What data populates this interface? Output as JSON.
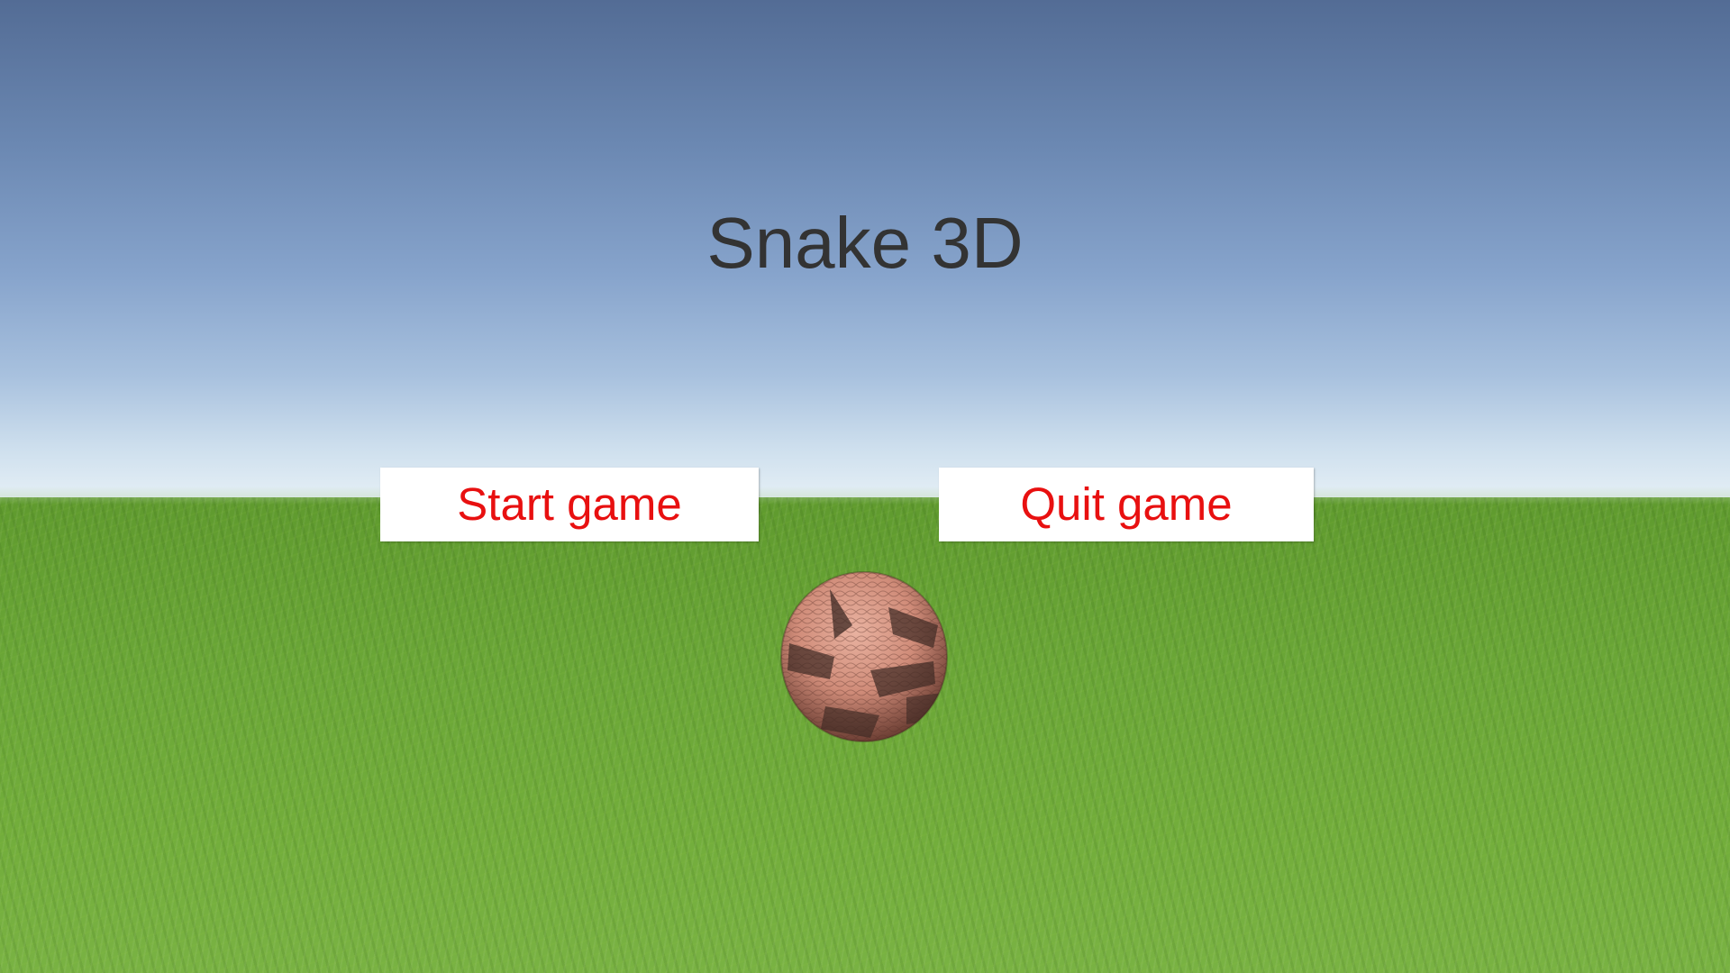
{
  "game": {
    "title": "Snake 3D"
  },
  "menu": {
    "start_label": "Start game",
    "quit_label": "Quit game"
  },
  "colors": {
    "button_text": "#e81010",
    "button_background": "#ffffff",
    "title_text": "#333333"
  },
  "scene": {
    "sky": "sky",
    "ground": "grass",
    "player": "snake-skin ball"
  }
}
